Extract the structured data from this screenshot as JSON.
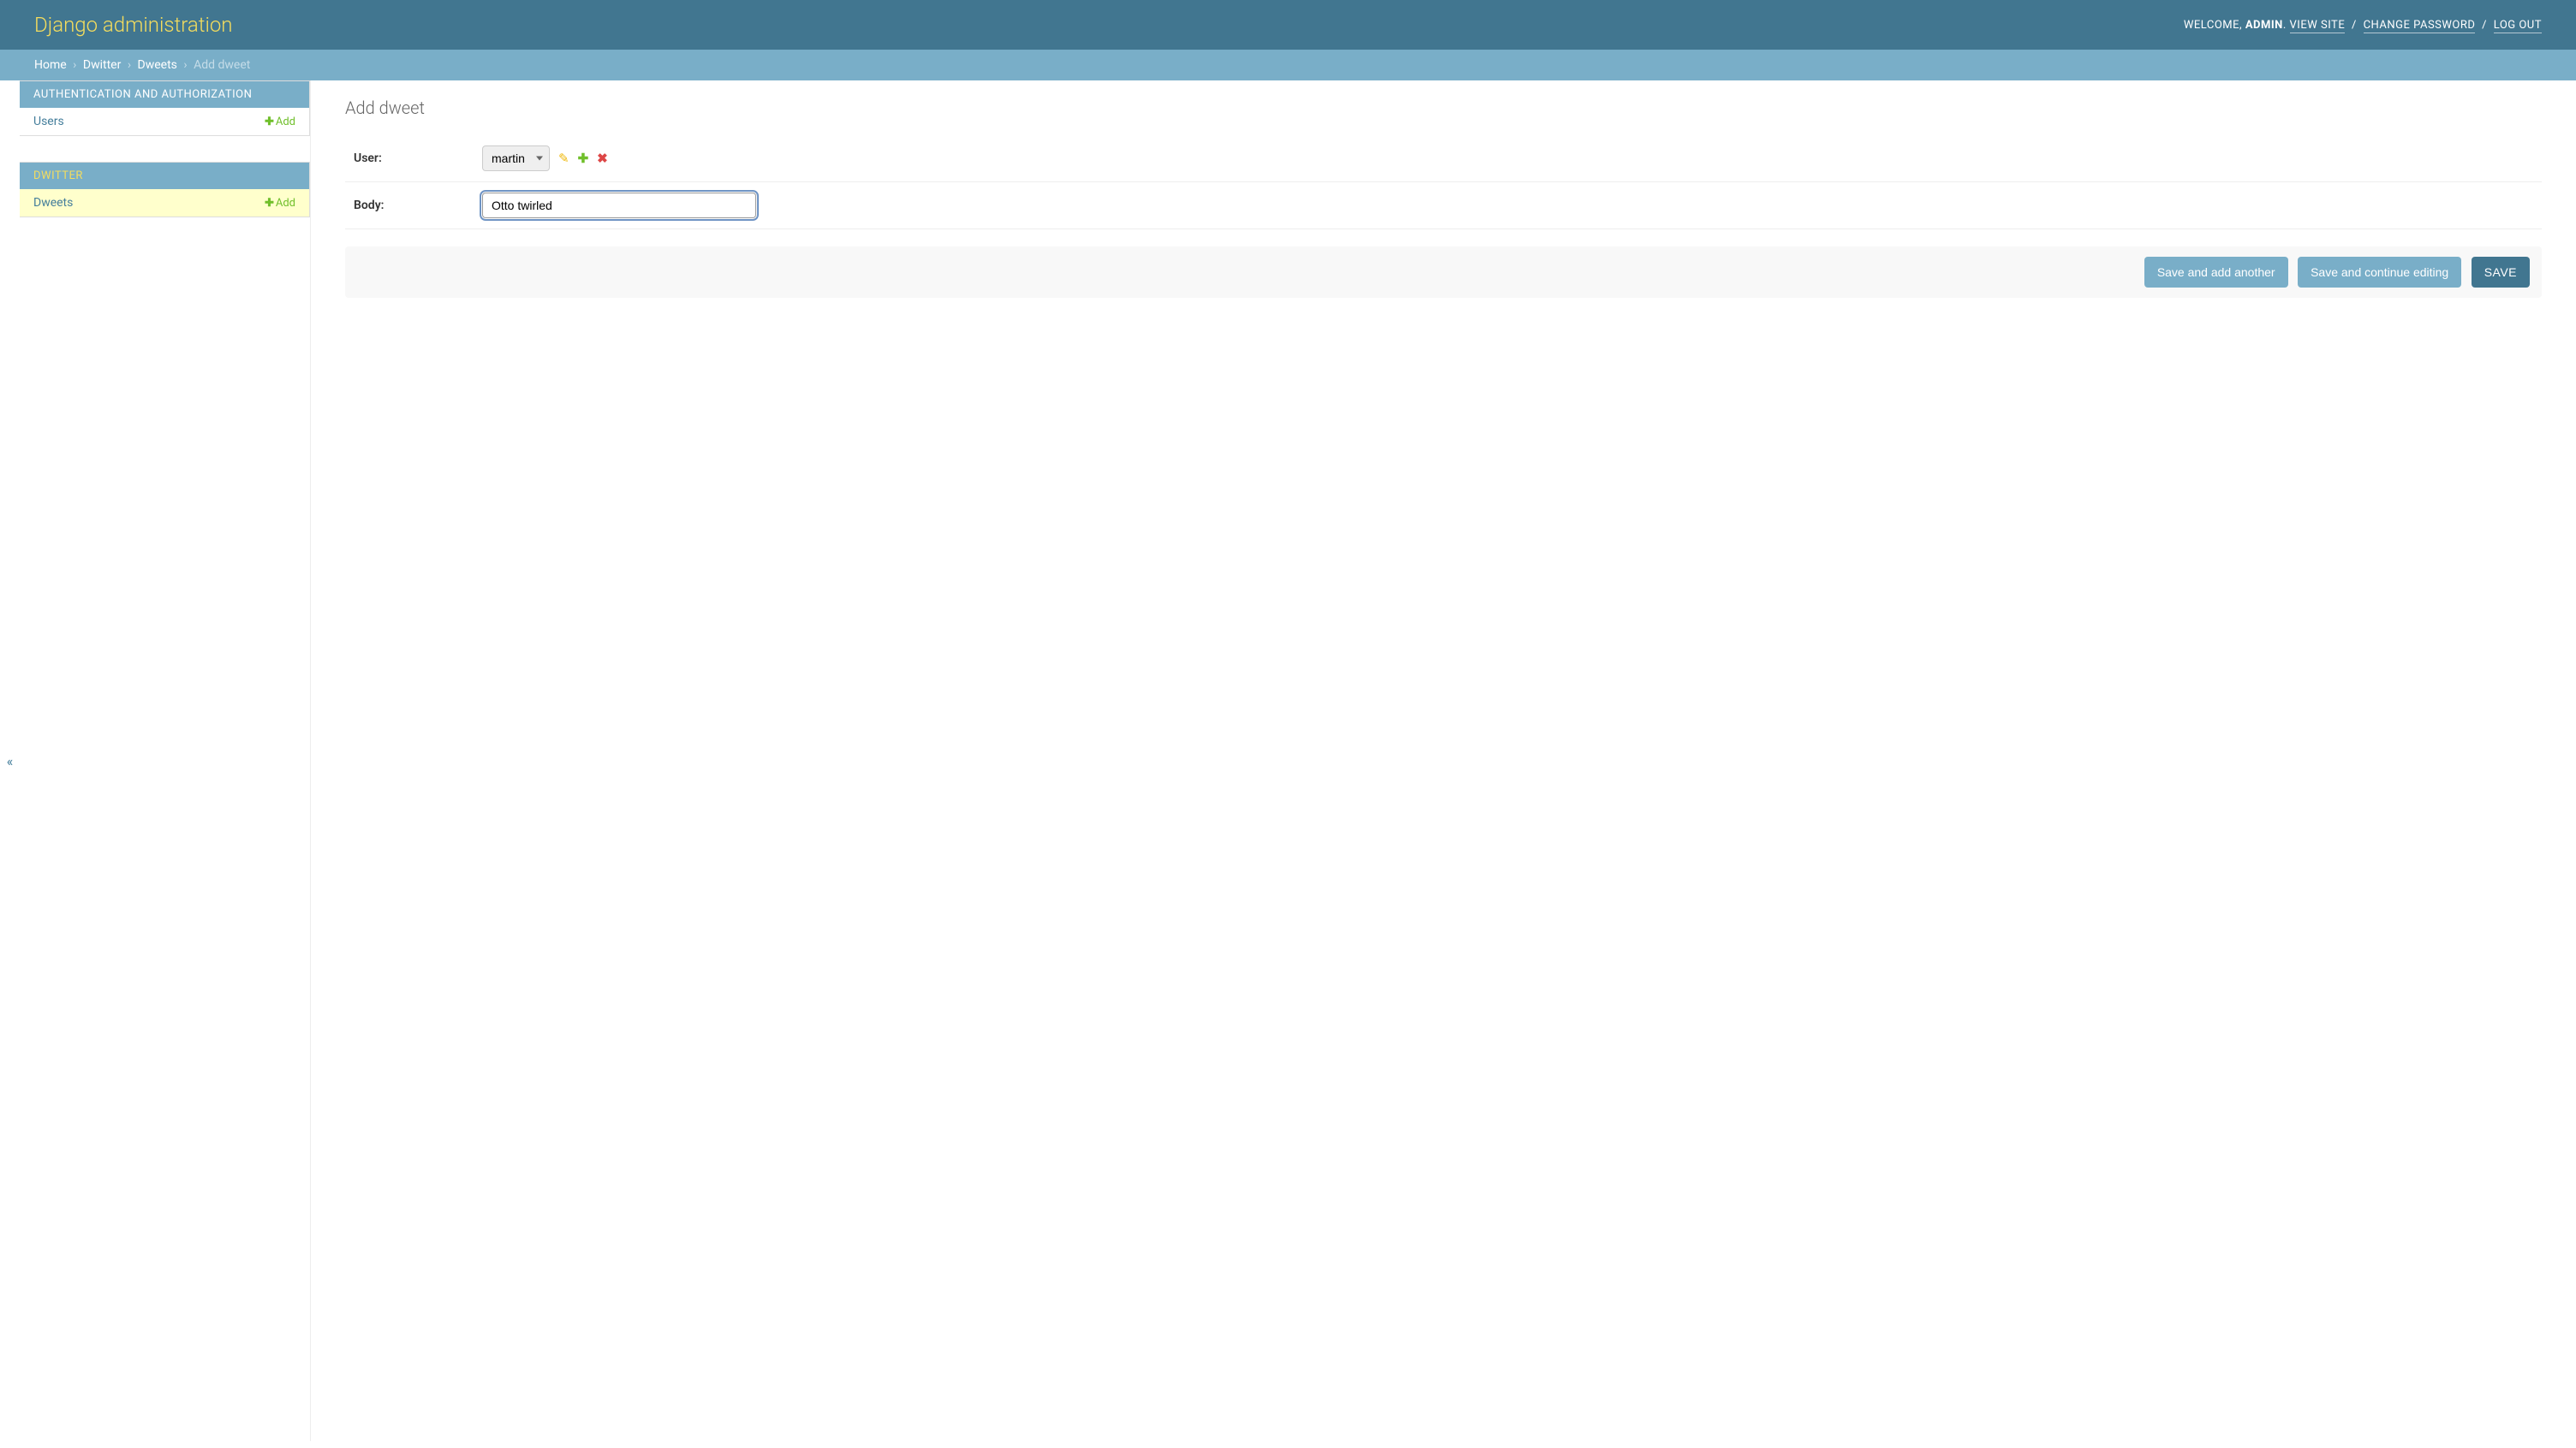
{
  "header": {
    "branding": "Django administration",
    "welcome": "WELCOME,",
    "username": "ADMIN",
    "view_site": "VIEW SITE",
    "change_password": "CHANGE PASSWORD",
    "logout": "LOG OUT"
  },
  "breadcrumbs": {
    "home": "Home",
    "app": "Dwitter",
    "model": "Dweets",
    "current": "Add dweet"
  },
  "sidebar": {
    "apps": [
      {
        "name": "AUTHENTICATION AND AUTHORIZATION",
        "current": false,
        "models": [
          {
            "name": "Users",
            "add_label": "Add",
            "current": false
          }
        ]
      },
      {
        "name": "DWITTER",
        "current": true,
        "models": [
          {
            "name": "Dweets",
            "add_label": "Add",
            "current": true
          }
        ]
      }
    ],
    "collapse_icon": "«"
  },
  "content": {
    "title": "Add dweet",
    "fields": {
      "user": {
        "label": "User:",
        "selected": "martin"
      },
      "body": {
        "label": "Body:",
        "value": "Otto twirled"
      }
    },
    "submit": {
      "save_add_another": "Save and add another",
      "save_continue": "Save and continue editing",
      "save": "SAVE"
    }
  }
}
